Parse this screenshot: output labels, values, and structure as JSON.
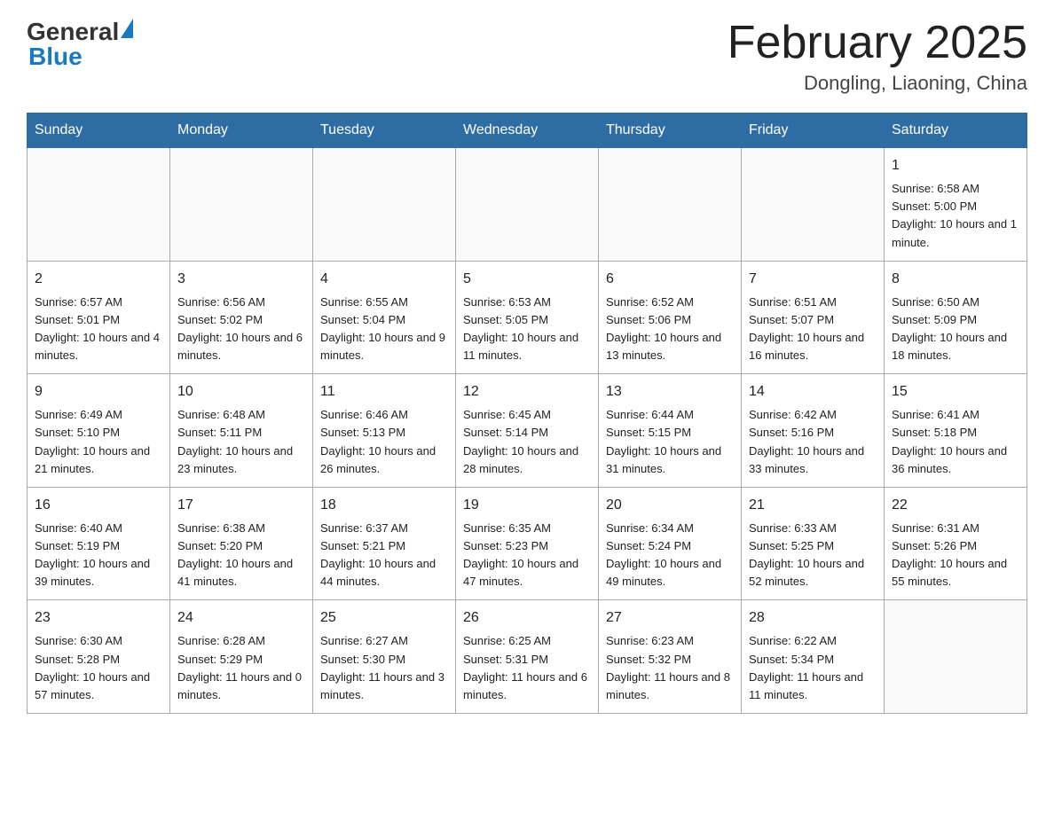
{
  "header": {
    "logo_general": "General",
    "logo_blue": "Blue",
    "title": "February 2025",
    "subtitle": "Dongling, Liaoning, China"
  },
  "days_of_week": [
    "Sunday",
    "Monday",
    "Tuesday",
    "Wednesday",
    "Thursday",
    "Friday",
    "Saturday"
  ],
  "weeks": [
    [
      {
        "day": "",
        "info": ""
      },
      {
        "day": "",
        "info": ""
      },
      {
        "day": "",
        "info": ""
      },
      {
        "day": "",
        "info": ""
      },
      {
        "day": "",
        "info": ""
      },
      {
        "day": "",
        "info": ""
      },
      {
        "day": "1",
        "info": "Sunrise: 6:58 AM\nSunset: 5:00 PM\nDaylight: 10 hours and 1 minute."
      }
    ],
    [
      {
        "day": "2",
        "info": "Sunrise: 6:57 AM\nSunset: 5:01 PM\nDaylight: 10 hours and 4 minutes."
      },
      {
        "day": "3",
        "info": "Sunrise: 6:56 AM\nSunset: 5:02 PM\nDaylight: 10 hours and 6 minutes."
      },
      {
        "day": "4",
        "info": "Sunrise: 6:55 AM\nSunset: 5:04 PM\nDaylight: 10 hours and 9 minutes."
      },
      {
        "day": "5",
        "info": "Sunrise: 6:53 AM\nSunset: 5:05 PM\nDaylight: 10 hours and 11 minutes."
      },
      {
        "day": "6",
        "info": "Sunrise: 6:52 AM\nSunset: 5:06 PM\nDaylight: 10 hours and 13 minutes."
      },
      {
        "day": "7",
        "info": "Sunrise: 6:51 AM\nSunset: 5:07 PM\nDaylight: 10 hours and 16 minutes."
      },
      {
        "day": "8",
        "info": "Sunrise: 6:50 AM\nSunset: 5:09 PM\nDaylight: 10 hours and 18 minutes."
      }
    ],
    [
      {
        "day": "9",
        "info": "Sunrise: 6:49 AM\nSunset: 5:10 PM\nDaylight: 10 hours and 21 minutes."
      },
      {
        "day": "10",
        "info": "Sunrise: 6:48 AM\nSunset: 5:11 PM\nDaylight: 10 hours and 23 minutes."
      },
      {
        "day": "11",
        "info": "Sunrise: 6:46 AM\nSunset: 5:13 PM\nDaylight: 10 hours and 26 minutes."
      },
      {
        "day": "12",
        "info": "Sunrise: 6:45 AM\nSunset: 5:14 PM\nDaylight: 10 hours and 28 minutes."
      },
      {
        "day": "13",
        "info": "Sunrise: 6:44 AM\nSunset: 5:15 PM\nDaylight: 10 hours and 31 minutes."
      },
      {
        "day": "14",
        "info": "Sunrise: 6:42 AM\nSunset: 5:16 PM\nDaylight: 10 hours and 33 minutes."
      },
      {
        "day": "15",
        "info": "Sunrise: 6:41 AM\nSunset: 5:18 PM\nDaylight: 10 hours and 36 minutes."
      }
    ],
    [
      {
        "day": "16",
        "info": "Sunrise: 6:40 AM\nSunset: 5:19 PM\nDaylight: 10 hours and 39 minutes."
      },
      {
        "day": "17",
        "info": "Sunrise: 6:38 AM\nSunset: 5:20 PM\nDaylight: 10 hours and 41 minutes."
      },
      {
        "day": "18",
        "info": "Sunrise: 6:37 AM\nSunset: 5:21 PM\nDaylight: 10 hours and 44 minutes."
      },
      {
        "day": "19",
        "info": "Sunrise: 6:35 AM\nSunset: 5:23 PM\nDaylight: 10 hours and 47 minutes."
      },
      {
        "day": "20",
        "info": "Sunrise: 6:34 AM\nSunset: 5:24 PM\nDaylight: 10 hours and 49 minutes."
      },
      {
        "day": "21",
        "info": "Sunrise: 6:33 AM\nSunset: 5:25 PM\nDaylight: 10 hours and 52 minutes."
      },
      {
        "day": "22",
        "info": "Sunrise: 6:31 AM\nSunset: 5:26 PM\nDaylight: 10 hours and 55 minutes."
      }
    ],
    [
      {
        "day": "23",
        "info": "Sunrise: 6:30 AM\nSunset: 5:28 PM\nDaylight: 10 hours and 57 minutes."
      },
      {
        "day": "24",
        "info": "Sunrise: 6:28 AM\nSunset: 5:29 PM\nDaylight: 11 hours and 0 minutes."
      },
      {
        "day": "25",
        "info": "Sunrise: 6:27 AM\nSunset: 5:30 PM\nDaylight: 11 hours and 3 minutes."
      },
      {
        "day": "26",
        "info": "Sunrise: 6:25 AM\nSunset: 5:31 PM\nDaylight: 11 hours and 6 minutes."
      },
      {
        "day": "27",
        "info": "Sunrise: 6:23 AM\nSunset: 5:32 PM\nDaylight: 11 hours and 8 minutes."
      },
      {
        "day": "28",
        "info": "Sunrise: 6:22 AM\nSunset: 5:34 PM\nDaylight: 11 hours and 11 minutes."
      },
      {
        "day": "",
        "info": ""
      }
    ]
  ]
}
